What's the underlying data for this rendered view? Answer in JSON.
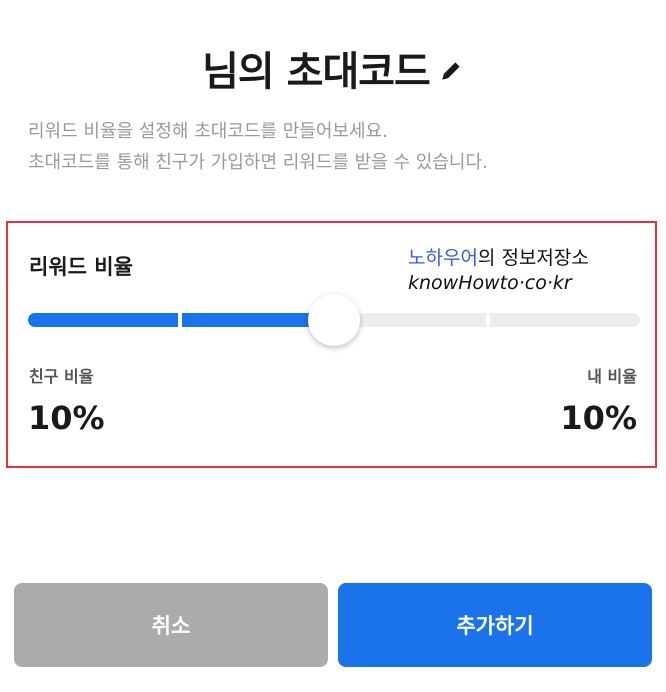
{
  "header": {
    "title": "님의 초대코드"
  },
  "description": {
    "line1": "리워드 비율을 설정해 초대코드를 만들어보세요.",
    "line2": "초대코드를 통해 친구가 가입하면 리워드를 받을 수 있습니다."
  },
  "reward": {
    "title": "리워드 비율",
    "slider_level": 2,
    "slider_steps": 4,
    "friend_label": "친구 비율",
    "friend_value": "10%",
    "my_label": "내 비율",
    "my_value": "10%"
  },
  "watermark": {
    "blue_text": "노하우어",
    "black_text": "의 정보저장소",
    "url": "knowHowto·co·kr"
  },
  "buttons": {
    "cancel": "취소",
    "add": "추가하기"
  },
  "colors": {
    "accent": "#1b73ec",
    "cancel_bg": "#ababab",
    "highlight_border": "#e0343a"
  }
}
